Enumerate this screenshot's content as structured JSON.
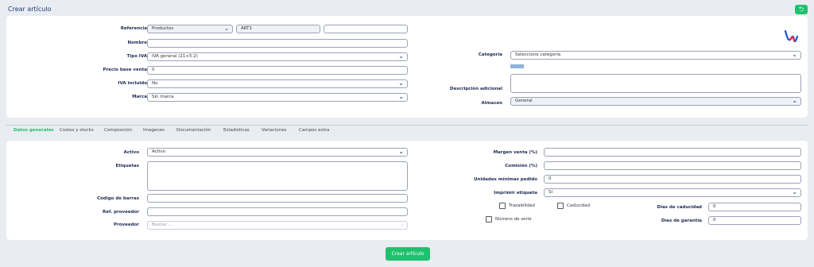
{
  "page": {
    "title": "Crear artículo"
  },
  "top": {
    "referencia_label": "Referencia",
    "referencia_select": "Productos",
    "referencia_code": "ART1",
    "referencia_extra": "",
    "nombre_label": "Nombre",
    "nombre_value": "",
    "tipo_iva_label": "Tipo IVA",
    "tipo_iva_value": "IVA general (21+5.2)",
    "precio_label": "Precio base venta",
    "precio_value": "0",
    "iva_incluido_label": "IVA incluido",
    "iva_incluido_value": "No",
    "marca_label": "Marca",
    "marca_value": "Sin marca",
    "categoria_label": "Categoría",
    "categoria_value": "Seleccione categoría",
    "descripcion_label": "Descripción adicional",
    "almacen_label": "Almacen",
    "almacen_value": "General"
  },
  "tabs": [
    {
      "label": "Datos generales",
      "active": true
    },
    {
      "label": "Costes y stocks"
    },
    {
      "label": "Composición"
    },
    {
      "label": "Imagenes"
    },
    {
      "label": "Documentación"
    },
    {
      "label": "Estadísticas"
    },
    {
      "label": "Variaciones"
    },
    {
      "label": "Campos extra"
    }
  ],
  "general": {
    "activo_label": "Activo",
    "activo_value": "Activo",
    "etiquetas_label": "Etiquetas",
    "codigo_barras_label": "Código de barras",
    "ref_proveedor_label": "Ref. proveedor",
    "proveedor_label": "Proveedor",
    "proveedor_placeholder": "Buscar ...",
    "margen_label": "Margen venta (%)",
    "comision_label": "Comisión (%)",
    "unidades_label": "Unidades mínimas pedido",
    "unidades_value": "0",
    "imprimir_label": "Imprimir etiqueta",
    "imprimir_value": "Sí",
    "trazabilidad_label": "Trazabilidad",
    "caducidad_label": "Caducidad",
    "dias_caducidad_label": "Días de caducidad",
    "dias_caducidad_value": "0",
    "numero_serie_label": "Número de serie",
    "dias_garantia_label": "Días de garantía",
    "dias_garantia_value": "0"
  },
  "actions": {
    "create_label": "Crear artículo"
  },
  "colors": {
    "accent": "#20c06e",
    "label": "#1e2a55"
  },
  "icons": {
    "back": "back-arrow-icon",
    "logo": "brand-logo-icon"
  }
}
